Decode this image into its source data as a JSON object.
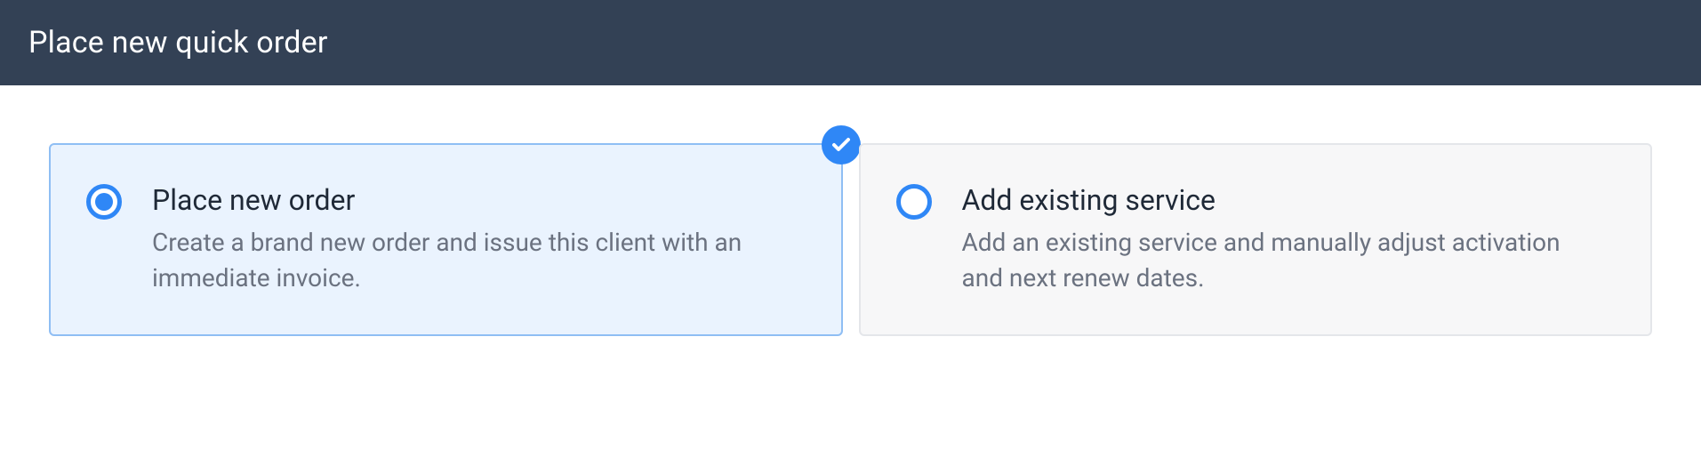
{
  "header": {
    "title": "Place new quick order"
  },
  "options": {
    "place_new_order": {
      "title": "Place new order",
      "description": "Create a brand new order and issue this client with an immediate invoice.",
      "selected": true
    },
    "add_existing_service": {
      "title": "Add existing service",
      "description": "Add an existing service and manually adjust activation and next renew dates.",
      "selected": false
    }
  },
  "colors": {
    "header_bg": "#334155",
    "accent": "#2f87f6",
    "selected_bg": "#eaf3fe",
    "selected_border": "#8fbef4",
    "unselected_bg": "#f7f7f8",
    "unselected_border": "#e4e6ea"
  }
}
